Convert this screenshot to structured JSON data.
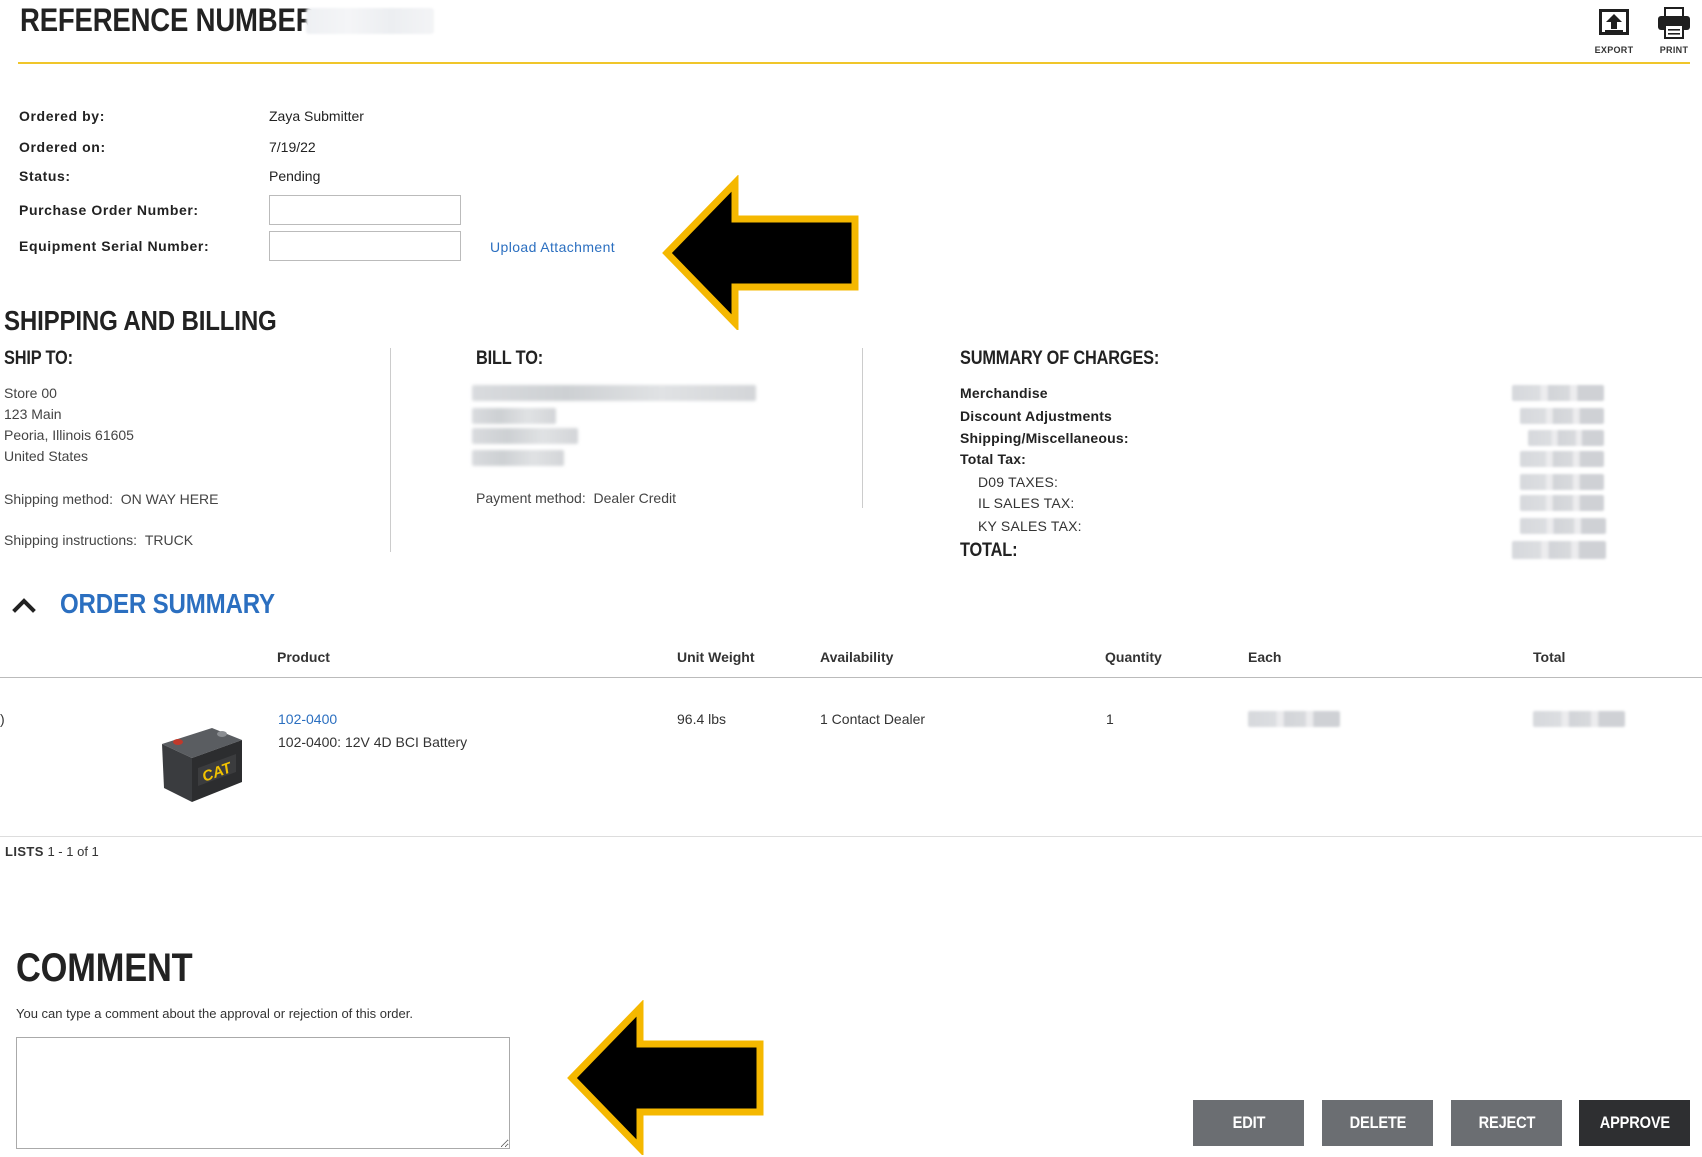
{
  "header": {
    "reference_label": "REFERENCE NUMBER:",
    "export_label": "EXPORT",
    "print_label": "PRINT"
  },
  "details": {
    "ordered_by_label": "Ordered by:",
    "ordered_by_value": "Zaya Submitter",
    "ordered_on_label": "Ordered on:",
    "ordered_on_value": "7/19/22",
    "status_label": "Status:",
    "status_value": "Pending",
    "po_label": "Purchase Order Number:",
    "po_value": "",
    "serial_label": "Equipment Serial Number:",
    "serial_value": "",
    "upload_link": "Upload Attachment"
  },
  "shipping_billing": {
    "title": "SHIPPING AND BILLING",
    "ship_to": {
      "heading": "SHIP TO:",
      "lines": [
        "Store 00",
        "123 Main",
        "Peoria, Illinois 61605",
        "United States"
      ],
      "method_label": "Shipping method:",
      "method_value": "ON WAY HERE",
      "instructions_label": "Shipping instructions:",
      "instructions_value": "TRUCK"
    },
    "bill_to": {
      "heading": "BILL TO:",
      "payment_label": "Payment method:",
      "payment_value": "Dealer Credit"
    },
    "summary": {
      "heading": "SUMMARY OF CHARGES:",
      "merchandise": "Merchandise",
      "discount": "Discount Adjustments",
      "shipping_misc": "Shipping/Miscellaneous:",
      "total_tax": "Total Tax:",
      "d09_taxes": "D09 TAXES:",
      "il_sales_tax": "IL SALES TAX:",
      "ky_sales_tax": "KY SALES TAX:",
      "total": "TOTAL:"
    }
  },
  "order_summary": {
    "title": "ORDER SUMMARY",
    "columns": {
      "product": "Product",
      "unit_weight": "Unit Weight",
      "availability": "Availability",
      "quantity": "Quantity",
      "each": "Each",
      "total": "Total"
    },
    "rows": [
      {
        "marker": ")",
        "part_number": "102-0400",
        "description": "102-0400: 12V 4D BCI Battery",
        "unit_weight": "96.4 lbs",
        "availability": "1 Contact Dealer",
        "quantity": "1"
      }
    ],
    "lists_label": "LISTS",
    "lists_range": "1 - 1 of 1",
    "battery_brand": "CAT"
  },
  "comment": {
    "title": "COMMENT",
    "hint": "You can type a comment about the approval or rejection of this order.",
    "value": ""
  },
  "actions": {
    "edit": "EDIT",
    "delete": "DELETE",
    "reject": "REJECT",
    "approve": "APPROVE"
  },
  "colors": {
    "accent_yellow": "#f0c62a",
    "link_blue": "#2b6fc0",
    "button_gray": "#6b6e72",
    "button_dark": "#2e2f31"
  }
}
